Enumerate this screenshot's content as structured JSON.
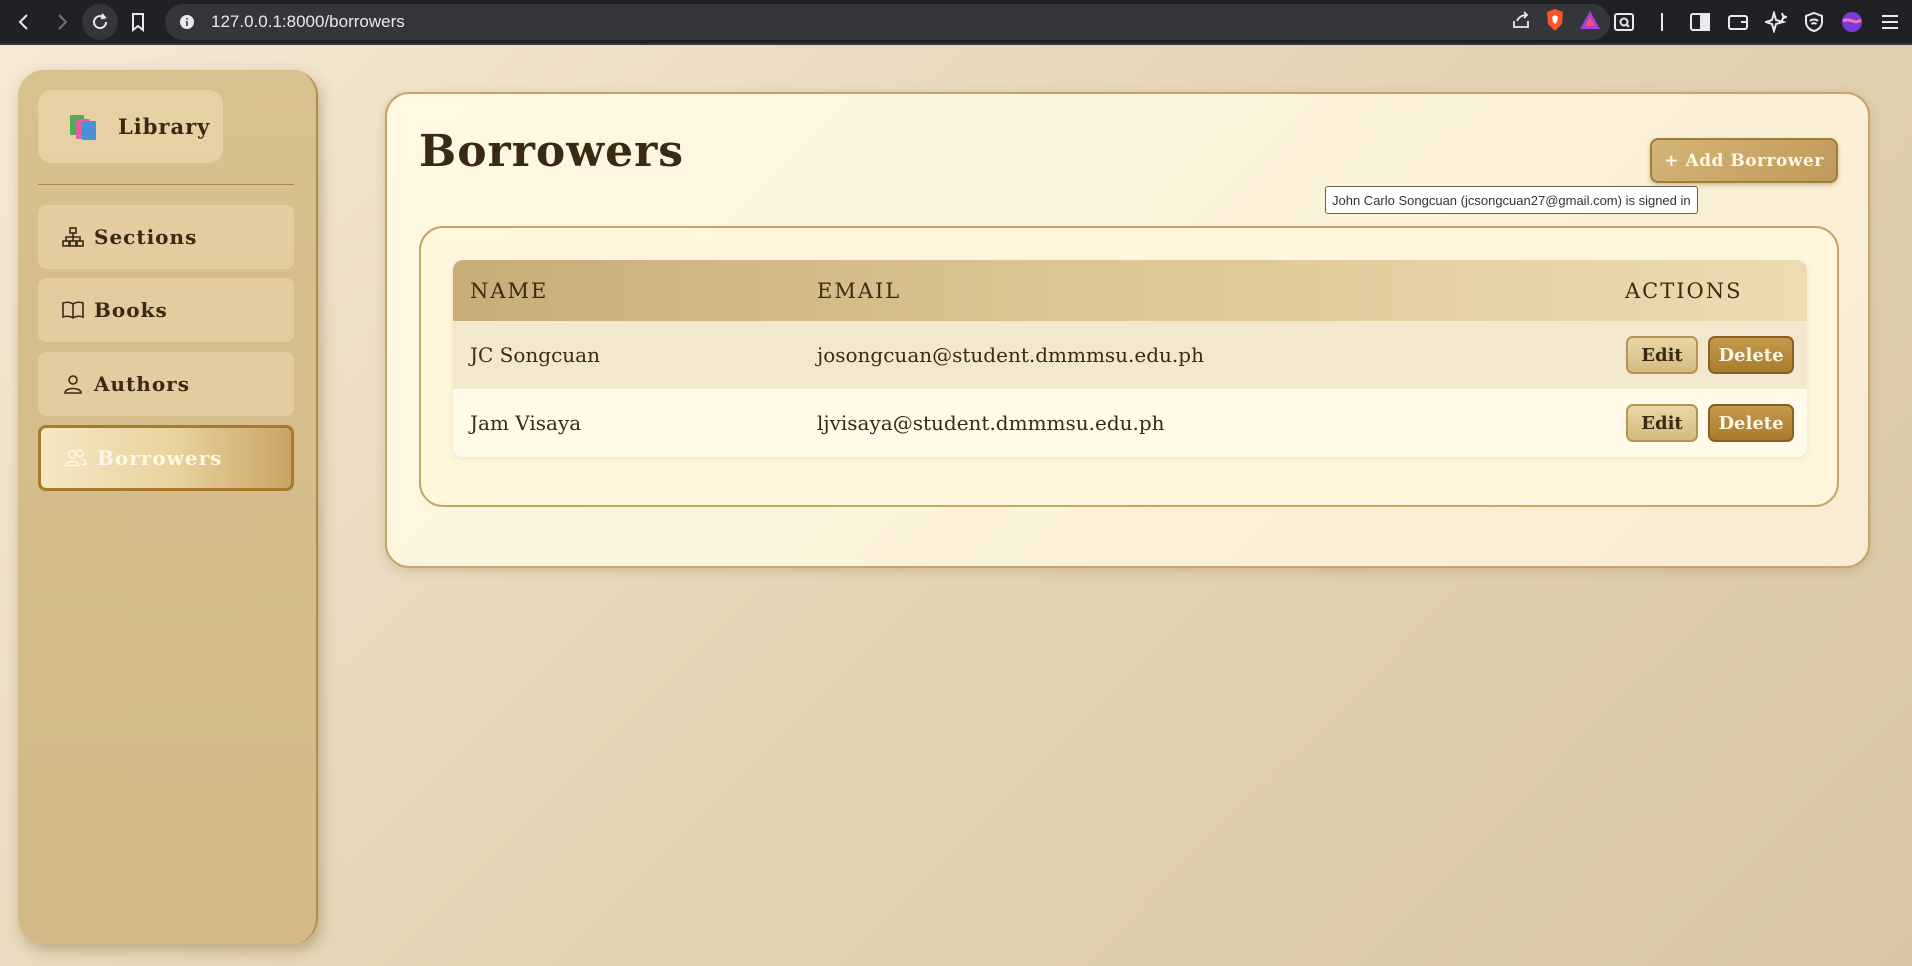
{
  "browser": {
    "url": "127.0.0.1:8000/borrowers"
  },
  "sidebar": {
    "brand": "Library",
    "items": [
      {
        "label": "Sections",
        "icon": "sitemap-icon",
        "active": false
      },
      {
        "label": "Books",
        "icon": "book-icon",
        "active": false
      },
      {
        "label": "Authors",
        "icon": "user-icon",
        "active": false
      },
      {
        "label": "Borrowers",
        "icon": "users-icon",
        "active": true
      }
    ]
  },
  "main": {
    "title": "Borrowers",
    "add_button": "+ Add Borrower",
    "tooltip": "John Carlo Songcuan (jcsongcuan27@gmail.com) is signed in",
    "table": {
      "headers": [
        "NAME",
        "EMAIL",
        "ACTIONS"
      ],
      "rows": [
        {
          "name": "JC Songcuan",
          "email": "josongcuan@student.dmmmsu.edu.ph"
        },
        {
          "name": "Jam Visaya",
          "email": "ljvisaya@student.dmmmsu.edu.ph"
        }
      ],
      "edit_label": "Edit",
      "delete_label": "Delete"
    }
  },
  "colors": {
    "accent": "#a87a2a",
    "panel": "#fff8e3",
    "text": "#3b2a12"
  }
}
